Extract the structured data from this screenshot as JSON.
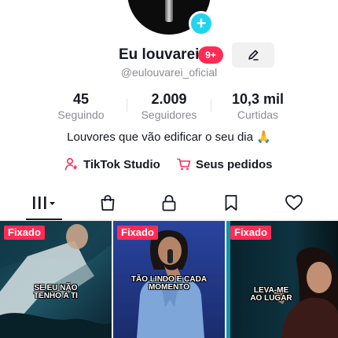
{
  "profile": {
    "name": "Eu louvarei",
    "notification_badge": "9+",
    "handle": "@eulouvarei_oficial",
    "bio": "Louvores que vão edificar o seu dia 🙏"
  },
  "stats": [
    {
      "value": "45",
      "label": "Seguindo"
    },
    {
      "value": "2.009",
      "label": "Seguidores"
    },
    {
      "value": "10,3 mil",
      "label": "Curtidas"
    }
  ],
  "links": {
    "studio": "TikTok Studio",
    "orders": "Seus pedidos"
  },
  "tabs": [
    {
      "icon": "grid-videos-icon"
    },
    {
      "icon": "shopping-bag-icon"
    },
    {
      "icon": "lock-icon"
    },
    {
      "icon": "bookmark-icon"
    },
    {
      "icon": "heart-icon"
    }
  ],
  "videos": [
    {
      "pinned_label": "Fixado",
      "caption_line1": "SE EU NÃO",
      "caption_line2": "TENHO A TI"
    },
    {
      "pinned_label": "Fixado",
      "caption_line1": "TÃO LINDO E CADA",
      "caption_line2": "MOMENTO"
    },
    {
      "pinned_label": "Fixado",
      "caption_line1": "LEVA-ME",
      "caption_line2": "AO LUGAR"
    }
  ],
  "colors": {
    "accent_red": "#fe2c55",
    "add_button_cyan": "#20d5ec",
    "muted_text": "#8a8b91"
  }
}
